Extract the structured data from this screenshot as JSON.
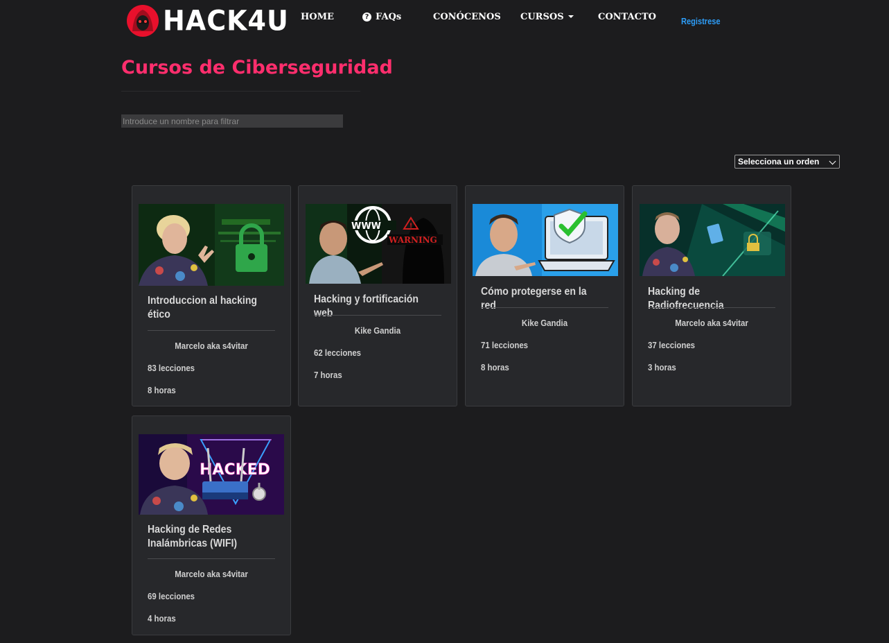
{
  "nav": {
    "logo_text": "HACK4U",
    "items": [
      {
        "label": "HOME"
      },
      {
        "label": "FAQs"
      },
      {
        "label": "CONÓCENOS"
      },
      {
        "label": "CURSOS"
      },
      {
        "label": "CONTACTO"
      }
    ],
    "register_label": "Registrese"
  },
  "page": {
    "title": "Cursos de Ciberseguridad",
    "filter_placeholder": "Introduce un nombre para filtrar",
    "order_selected": "Selecciona un orden"
  },
  "courses": [
    {
      "title": "Introduccion al hacking ético",
      "author": "Marcelo aka s4vitar",
      "lessons": "83 lecciones",
      "hours": "8 horas"
    },
    {
      "title": "Hacking y fortificación web",
      "author": "Kike Gandia",
      "lessons": "62 lecciones",
      "hours": "7 horas",
      "thumb_text": [
        "WWW",
        "WARNING"
      ]
    },
    {
      "title": "Cómo protegerse en la red",
      "author": "Kike Gandia",
      "lessons": "71 lecciones",
      "hours": "8 horas"
    },
    {
      "title": "Hacking de Radiofrecuencia",
      "author": "Marcelo aka s4vitar",
      "lessons": "37 lecciones",
      "hours": "3 horas"
    },
    {
      "title": "Hacking de Redes Inalámbricas (WIFI)",
      "author": "Marcelo aka s4vitar",
      "lessons": "69 lecciones",
      "hours": "4 horas",
      "thumb_text": [
        "HACKED"
      ]
    }
  ],
  "colors": {
    "accent": "#ff2e6d",
    "link": "#2d9cf6",
    "background": "#1c1c1e",
    "card": "#27282b"
  }
}
